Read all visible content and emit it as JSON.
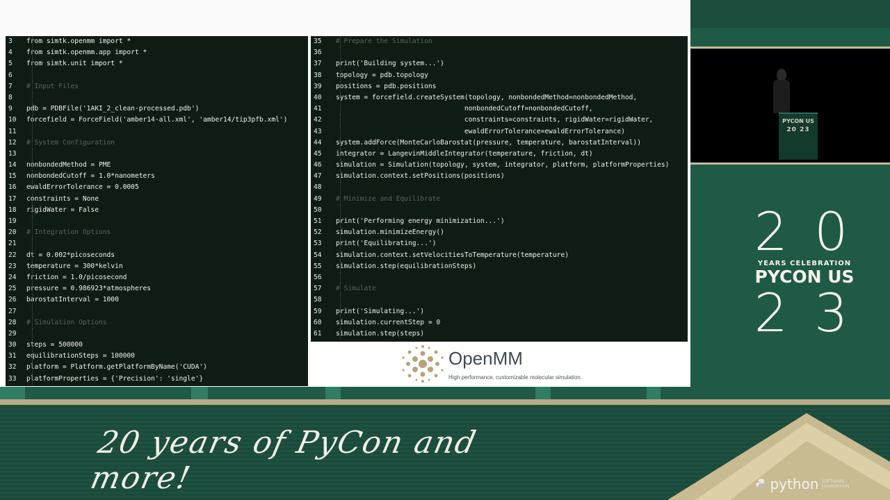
{
  "code_left": [
    {
      "n": "3",
      "t": "from simtk.openmm import *"
    },
    {
      "n": "4",
      "t": "from simtk.openmm.app import *"
    },
    {
      "n": "5",
      "t": "from simtk.unit import *"
    },
    {
      "n": "6",
      "t": ""
    },
    {
      "n": "7",
      "t": "# Input Files",
      "c": true
    },
    {
      "n": "8",
      "t": ""
    },
    {
      "n": "9",
      "t": "pdb = PDBFile('1AKI_2_clean-processed.pdb')"
    },
    {
      "n": "10",
      "t": "forcefield = ForceField('amber14-all.xml', 'amber14/tip3pfb.xml')"
    },
    {
      "n": "11",
      "t": ""
    },
    {
      "n": "12",
      "t": "# System Configuration",
      "c": true
    },
    {
      "n": "13",
      "t": ""
    },
    {
      "n": "14",
      "t": "nonbondedMethod = PME"
    },
    {
      "n": "15",
      "t": "nonbondedCutoff = 1.0*nanometers"
    },
    {
      "n": "16",
      "t": "ewaldErrorTolerance = 0.0005"
    },
    {
      "n": "17",
      "t": "constraints = None"
    },
    {
      "n": "18",
      "t": "rigidWater = False"
    },
    {
      "n": "19",
      "t": ""
    },
    {
      "n": "20",
      "t": "# Integration Options",
      "c": true
    },
    {
      "n": "21",
      "t": ""
    },
    {
      "n": "22",
      "t": "dt = 0.002*picoseconds"
    },
    {
      "n": "23",
      "t": "temperature = 300*kelvin"
    },
    {
      "n": "24",
      "t": "friction = 1.0/picosecond"
    },
    {
      "n": "25",
      "t": "pressure = 0.986923*atmospheres"
    },
    {
      "n": "26",
      "t": "barostatInterval = 1000"
    },
    {
      "n": "27",
      "t": ""
    },
    {
      "n": "28",
      "t": "# Simulation Options",
      "c": true
    },
    {
      "n": "29",
      "t": ""
    },
    {
      "n": "30",
      "t": "steps = 500000"
    },
    {
      "n": "31",
      "t": "equilibrationSteps = 100000"
    },
    {
      "n": "32",
      "t": "platform = Platform.getPlatformByName('CUDA')"
    },
    {
      "n": "33",
      "t": "platformProperties = {'Precision': 'single'}"
    }
  ],
  "code_right": [
    {
      "n": "35",
      "t": "# Prepare the Simulation",
      "c": true
    },
    {
      "n": "36",
      "t": ""
    },
    {
      "n": "37",
      "t": "print('Building system...')"
    },
    {
      "n": "38",
      "t": "topology = pdb.topology"
    },
    {
      "n": "39",
      "t": "positions = pdb.positions"
    },
    {
      "n": "40",
      "t": "system = forcefield.createSystem(topology, nonbondedMethod=nonbondedMethod,"
    },
    {
      "n": "41",
      "t": "                                nonbondedCutoff=nonbondedCutoff,"
    },
    {
      "n": "42",
      "t": "                                constraints=constraints, rigidWater=rigidWater,"
    },
    {
      "n": "43",
      "t": "                                ewaldErrorTolerance=ewaldErrorTolerance)"
    },
    {
      "n": "44",
      "t": "system.addForce(MonteCarloBarostat(pressure, temperature, barostatInterval))"
    },
    {
      "n": "45",
      "t": "integrator = LangevinMiddleIntegrator(temperature, friction, dt)"
    },
    {
      "n": "46",
      "t": "simulation = Simulation(topology, system, integrator, platform, platformProperties)"
    },
    {
      "n": "47",
      "t": "simulation.context.setPositions(positions)"
    },
    {
      "n": "48",
      "t": ""
    },
    {
      "n": "49",
      "t": "# Minimize and Equilibrate",
      "c": true
    },
    {
      "n": "50",
      "t": ""
    },
    {
      "n": "51",
      "t": "print('Performing energy minimization...')"
    },
    {
      "n": "52",
      "t": "simulation.minimizeEnergy()"
    },
    {
      "n": "53",
      "t": "print('Equilibrating...')"
    },
    {
      "n": "54",
      "t": "simulation.context.setVelocitiesToTemperature(temperature)"
    },
    {
      "n": "55",
      "t": "simulation.step(equilibrationSteps)"
    },
    {
      "n": "56",
      "t": ""
    },
    {
      "n": "57",
      "t": "# Simulate",
      "c": true
    },
    {
      "n": "58",
      "t": ""
    },
    {
      "n": "59",
      "t": "print('Simulating...')"
    },
    {
      "n": "60",
      "t": "simulation.currentStep = 0"
    },
    {
      "n": "61",
      "t": "simulation.step(steps)"
    }
  ],
  "openmm": {
    "name": "OpenMM",
    "subtitle": "High performance, customizable molecular simulation."
  },
  "brand": {
    "num_top": "20",
    "years": "YEARS CELEBRATION",
    "name": "PYCON US",
    "num_bottom": "23"
  },
  "podium": {
    "name": "PYCON US",
    "year": "20 23"
  },
  "tagline": "20 years of PyCon and more!",
  "psf": {
    "word": "python",
    "sub": "SOFTWARE FOUNDATION"
  },
  "colors": {
    "code_bg": "#0f1c14",
    "brand_green": "#1e5a45",
    "sand": "#c8bd98"
  }
}
